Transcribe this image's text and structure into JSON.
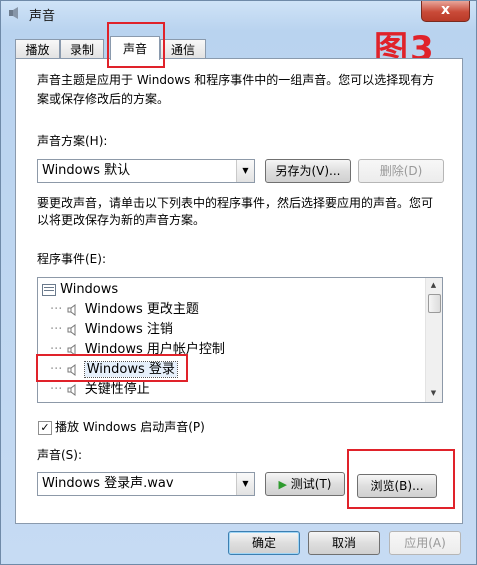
{
  "window": {
    "title": "声音",
    "close_glyph": "x"
  },
  "annotation": {
    "figure_label": "图3"
  },
  "tabs": [
    {
      "label": "播放"
    },
    {
      "label": "录制"
    },
    {
      "label": "声音",
      "active": true
    },
    {
      "label": "通信"
    }
  ],
  "theme_section": {
    "description_line1": "声音主题是应用于 Windows 和程序事件中的一组声音。您可以选择现有方",
    "description_line2": "案或保存修改后的方案。",
    "scheme_label": "声音方案(H):",
    "scheme_value": "Windows 默认",
    "save_as_label": "另存为(V)...",
    "delete_label": "删除(D)"
  },
  "events_section": {
    "instruction_line1": "要更改声音，请单击以下列表中的程序事件，然后选择要应用的声音。您可",
    "instruction_line2": "以将更改保存为新的声音方案。",
    "events_label": "程序事件(E):",
    "items": [
      {
        "label": "Windows",
        "group": true
      },
      {
        "label": "Windows 更改主题"
      },
      {
        "label": "Windows 注销"
      },
      {
        "label": "Windows 用户帐户控制"
      },
      {
        "label": "Windows 登录",
        "selected": true
      },
      {
        "label": "关键性停止"
      }
    ]
  },
  "startup": {
    "label": "播放 Windows 启动声音(P)",
    "checked": true,
    "check_glyph": "✓"
  },
  "sound": {
    "label": "声音(S):",
    "value": "Windows 登录声.wav",
    "test_label": "测试(T)",
    "browse_label": "浏览(B)..."
  },
  "footer": {
    "ok_label": "确定",
    "cancel_label": "取消",
    "apply_label": "应用(A)"
  },
  "colors": {
    "highlight_red": "#e0222a",
    "titlebar": "#b9d3ef",
    "play_green": "#2e9b2e"
  }
}
